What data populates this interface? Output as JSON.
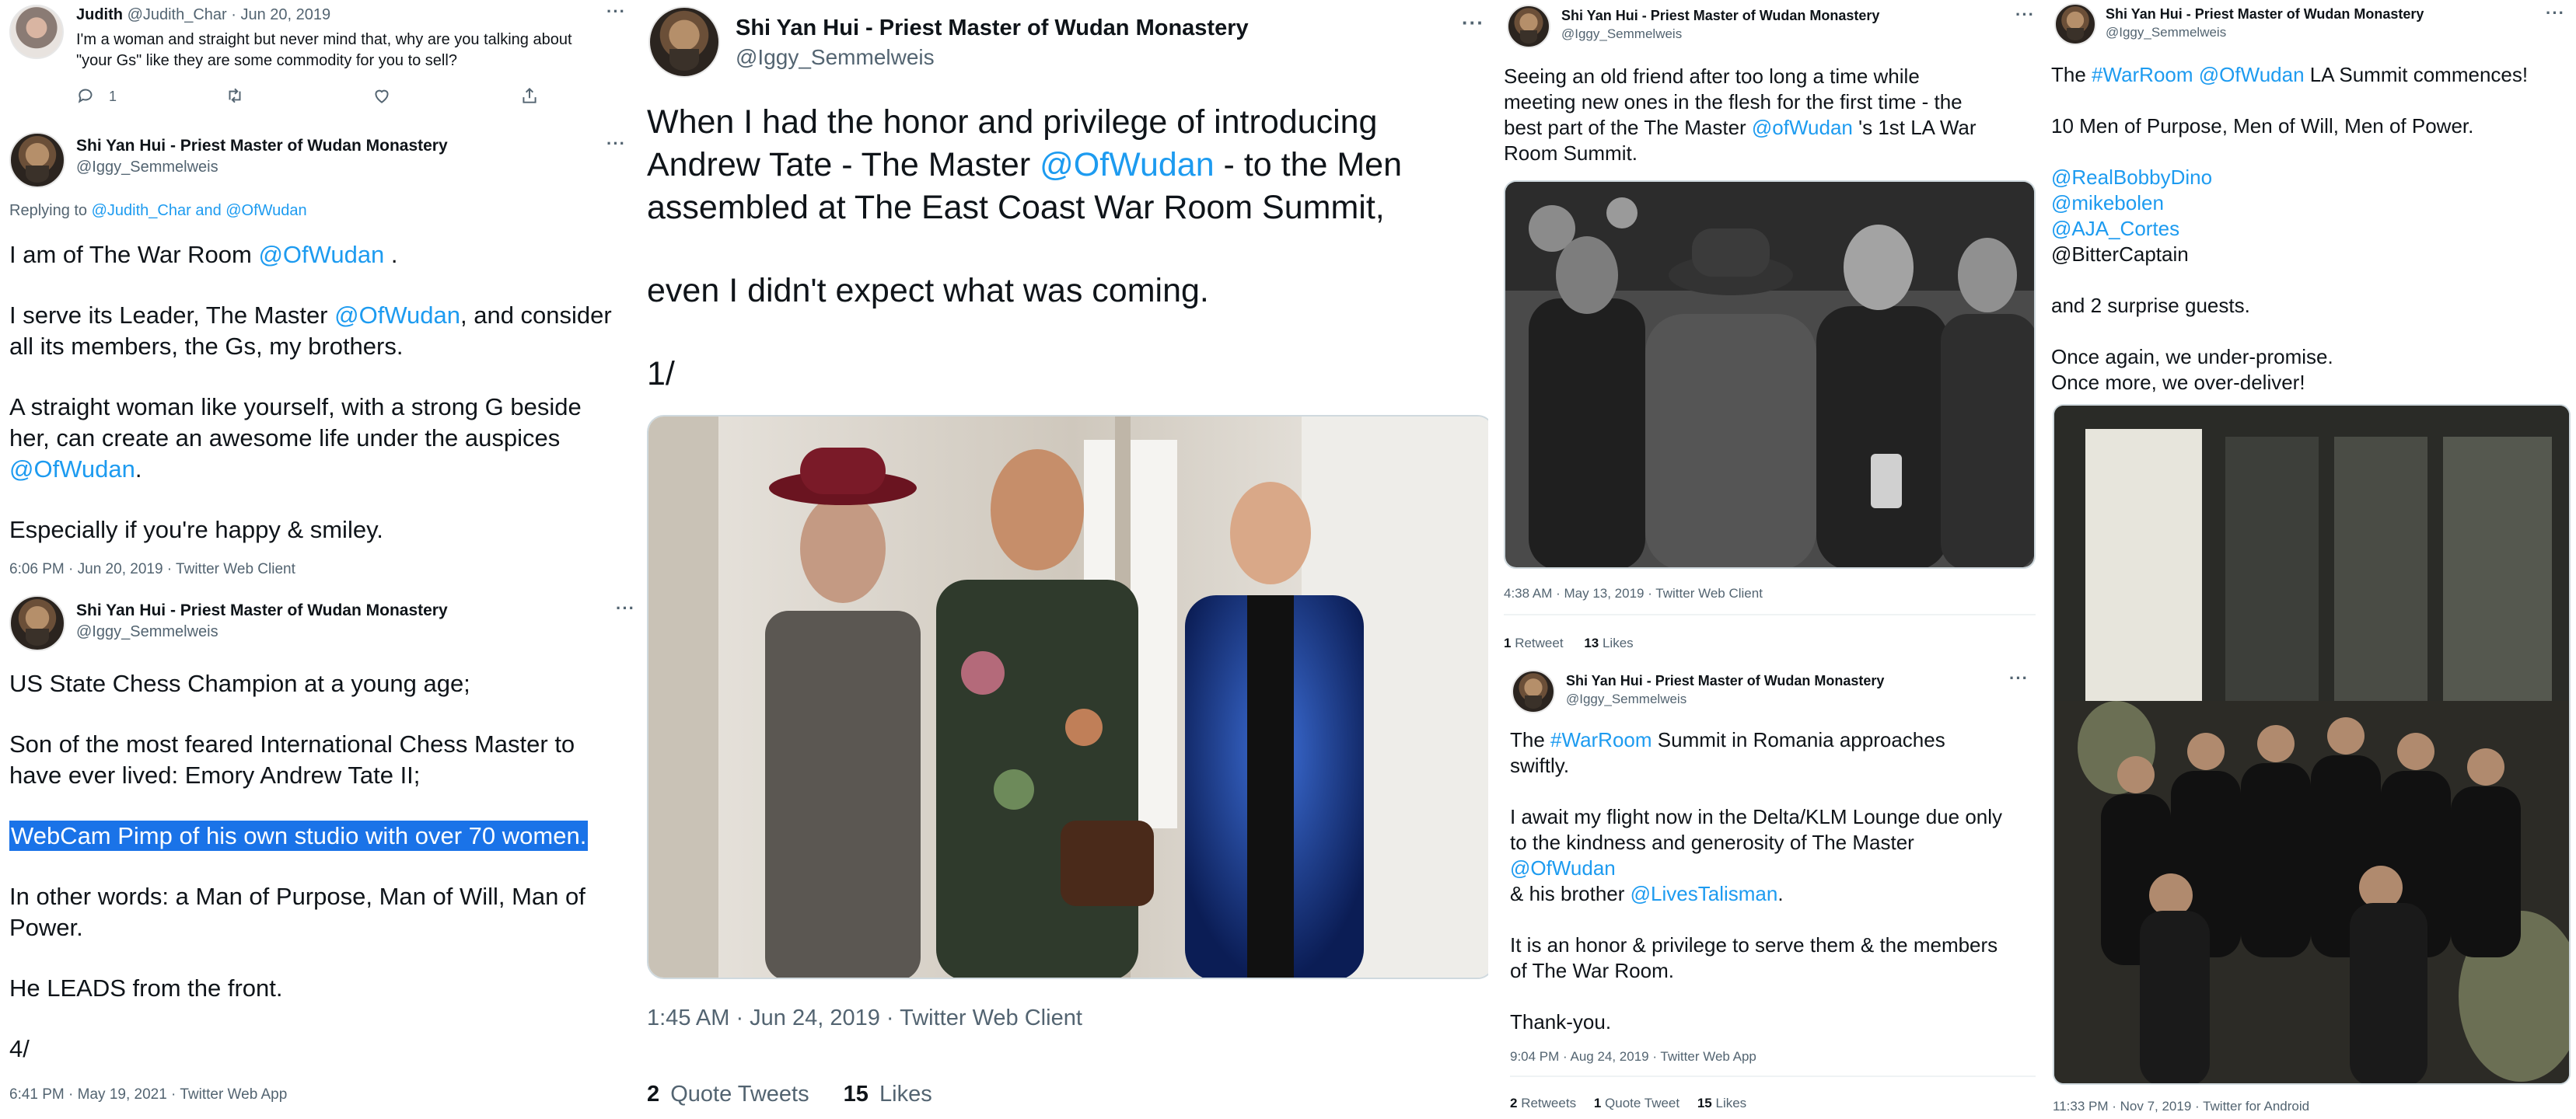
{
  "col1": {
    "judith": {
      "name": "Judith",
      "handle": "@Judith_Char",
      "date": "· Jun 20, 2019",
      "text": "I'm a woman and straight but never mind that, why are you talking about\n\"your Gs\" like they are some commodity for you to sell?",
      "reply_count": "1"
    },
    "tweet1": {
      "name": "Shi Yan Hui - Priest Master of Wudan Monastery",
      "handle": "@Iggy_Semmelweis",
      "replying_prefix": "Replying to",
      "replying_to": "@Judith_Char and @OfWudan",
      "p1_a": "I am of The War Room ",
      "p1_link": "@OfWudan",
      "p1_b": " .",
      "p2_a": "I serve its Leader, The Master ",
      "p2_link": "@OfWudan",
      "p2_b": ", and consider\nall its members, the Gs, my brothers.",
      "p3_a": "A straight woman like yourself, with a strong G beside\nher, can create an awesome life under the auspices\n",
      "p3_link": "@OfWudan",
      "p3_b": ".",
      "p4": "Especially if you're happy & smiley.",
      "timestamp": "6:06 PM · Jun 20, 2019 · Twitter Web Client"
    },
    "tweet2": {
      "name": "Shi Yan Hui - Priest Master of Wudan Monastery",
      "handle": "@Iggy_Semmelweis",
      "p1": "US State Chess Champion at a young age;",
      "p2": "Son of the most feared International Chess Master to\nhave ever lived: Emory Andrew Tate II;",
      "p3_selected": "WebCam Pimp of his own studio with over 70 women.",
      "p4": "In other words: a Man of Purpose, Man of Will, Man of\nPower.",
      "p5": "He LEADS from the front.",
      "p6": "4/",
      "timestamp": "6:41 PM · May 19, 2021 · Twitter Web App"
    }
  },
  "col2": {
    "name": "Shi Yan Hui - Priest Master of Wudan Monastery",
    "handle": "@Iggy_Semmelweis",
    "p1_a": "When I had the honor and privilege of introducing\nAndrew Tate - The Master ",
    "p1_link": "@OfWudan",
    "p1_b": " - to the Men\nassembled at The East Coast War Room Summit,",
    "p2": "even I didn't expect what was coming.",
    "p3": "1/",
    "timestamp": "1:45 AM · Jun 24, 2019 · Twitter Web Client",
    "quote_count": "2",
    "quote_label": "Quote Tweets",
    "like_count": "15",
    "like_label": "Likes"
  },
  "col3": {
    "tweet1": {
      "name": "Shi Yan Hui - Priest Master of Wudan Monastery",
      "handle": "@Iggy_Semmelweis",
      "text_a": "Seeing an old friend after too long a time while\nmeeting new ones in the flesh for the first time - the\nbest part of the The Master ",
      "text_link": "@ofWudan",
      "text_b": " 's 1st LA War\nRoom Summit.",
      "timestamp": "4:38 AM · May 13, 2019 · Twitter Web Client",
      "retweet_count": "1",
      "retweet_label": "Retweet",
      "like_count": "13",
      "like_label": "Likes"
    },
    "tweet2": {
      "name": "Shi Yan Hui - Priest Master of Wudan Monastery",
      "handle": "@Iggy_Semmelweis",
      "p1_a": "The ",
      "p1_link": "#WarRoom",
      "p1_b": " Summit in Romania approaches\nswiftly.",
      "p2_a": "I await my flight now in the Delta/KLM Lounge due only\nto the kindness and generosity of The Master\n",
      "p2_link1": "@OfWudan",
      "p2_b": "\n & his brother ",
      "p2_link2": "@LivesTalisman",
      "p2_c": ".",
      "p3": "It is an honor & privilege to serve them & the members\nof The War Room.",
      "p4": "Thank-you.",
      "timestamp": "9:04 PM · Aug 24, 2019 · Twitter Web App",
      "retweets_count": "2",
      "retweets_label": "Retweets",
      "quote_count": "1",
      "quote_label": "Quote Tweet",
      "like_count": "15",
      "like_label": "Likes"
    }
  },
  "col4": {
    "name": "Shi Yan Hui - Priest Master of Wudan Monastery",
    "handle": "@Iggy_Semmelweis",
    "p1_a": "The ",
    "p1_link1": "#WarRoom",
    "p1_sp": " ",
    "p1_link2": "@OfWudan",
    "p1_b": " LA Summit commences!",
    "p2": "10 Men of Purpose, Men of Will, Men of Power.",
    "mention1": "@RealBobbyDino",
    "mention2": "@mikebolen",
    "mention3": "@AJA_Cortes",
    "mention4": "@BitterCaptain",
    "p3": "and 2 surprise guests.",
    "p4": "Once again, we under-promise.\nOnce more, we over-deliver!",
    "timestamp": "11:33 PM · Nov 7, 2019 · Twitter for Android"
  },
  "colors": {
    "link": "#1d9bf0",
    "selection": "#1a73e8",
    "meta": "#536471"
  },
  "icons": [
    "reply-icon",
    "retweet-icon",
    "like-icon",
    "share-icon",
    "more-icon"
  ]
}
